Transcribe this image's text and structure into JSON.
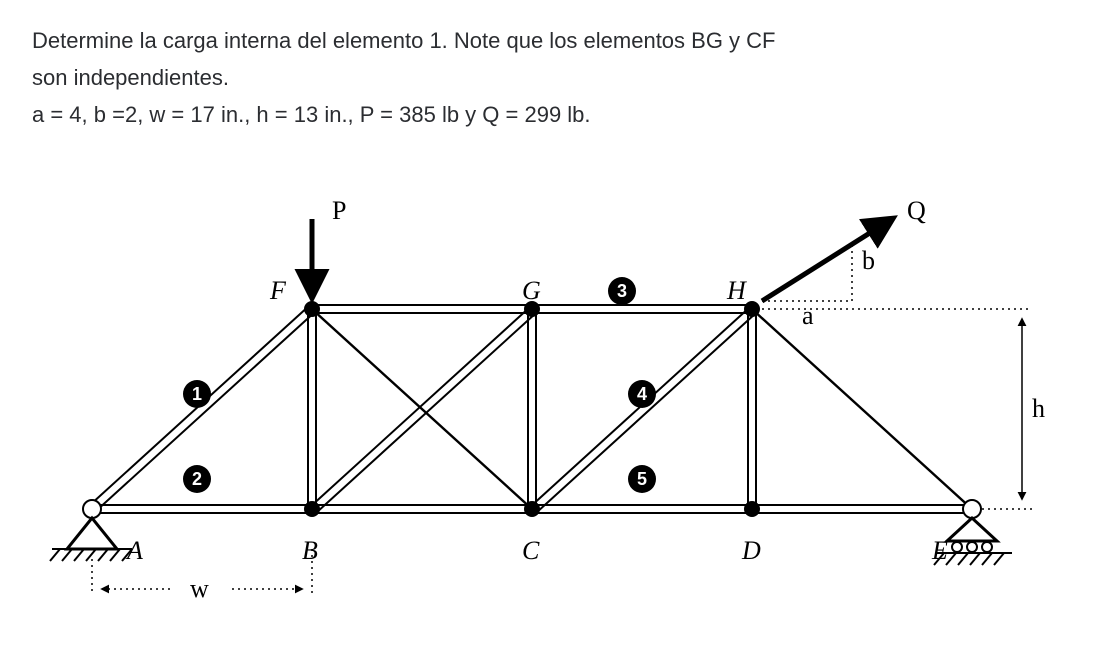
{
  "problem": {
    "line1": "Determine la carga interna del elemento 1. Note que los elementos BG y CF",
    "line2": "son independientes.",
    "line3": "a = 4, b =2, w = 17 in., h = 13 in., P = 385 lb y Q = 299 lb."
  },
  "loads": {
    "P_label": "P",
    "Q_label": "Q"
  },
  "nodes": {
    "A": "A",
    "B": "B",
    "C": "C",
    "D": "D",
    "E": "E",
    "F": "F",
    "G": "G",
    "H": "H"
  },
  "dims": {
    "w": "w",
    "h": "h",
    "a": "a",
    "b": "b"
  },
  "badges": {
    "b1": "1",
    "b2": "2",
    "b3": "3",
    "b4": "4",
    "b5": "5"
  },
  "chart_data": {
    "type": "diagram",
    "description": "Planar truss with bottom chord A-B-C-D-E and top chord F-G-H. Members: AF (1), AB (2), BF, FC, FG, BG, CG, GH (3), CH (4), CD (5), DH, HE, DE. BG and CF cross but are independent. Pin support at A, roller at E. Point load P downward at F. Force Q applied at H at angle defined by horizontal a and vertical b.",
    "parameters": {
      "a": 4,
      "b": 2,
      "w_in": 17,
      "h_in": 13,
      "P_lb": 385,
      "Q_lb": 299
    },
    "bottom_nodes": [
      "A",
      "B",
      "C",
      "D",
      "E"
    ],
    "top_nodes": [
      "F",
      "G",
      "H"
    ],
    "members_numbered": {
      "1": "AF",
      "2": "AB",
      "3": "GH",
      "4": "CH",
      "5": "CD"
    },
    "supports": {
      "A": "pin",
      "E": "roller"
    },
    "loads": {
      "P": {
        "at": "F",
        "dir": "down"
      },
      "Q": {
        "at": "H",
        "dir": "up-right via a,b"
      }
    }
  }
}
